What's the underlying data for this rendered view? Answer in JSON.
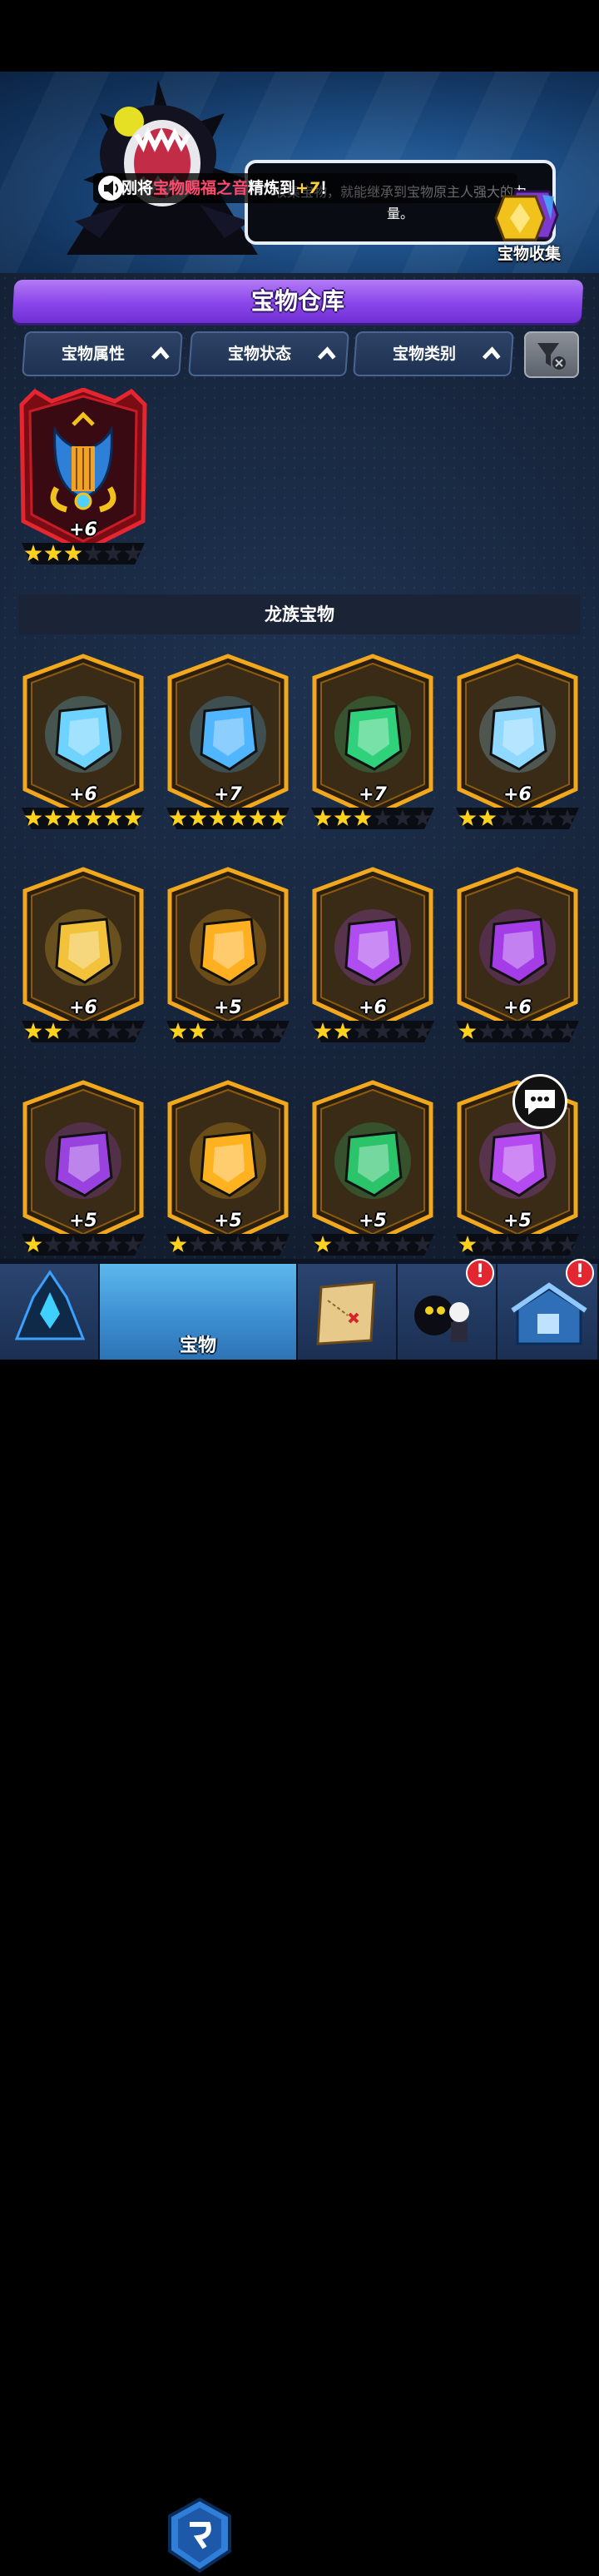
{
  "hero": {
    "dialog_text": "收集宝物，就能继承到宝物原主人强大的力量。",
    "ticker": {
      "prefix": "刚将",
      "item": "宝物赐福之音",
      "middle": "精炼到",
      "level": "+7",
      "suffix": "！"
    },
    "collection_label": "宝物收集"
  },
  "warehouse": {
    "title": "宝物仓库",
    "filters": [
      "宝物属性",
      "宝物状态",
      "宝物类别"
    ],
    "featured": {
      "level": "+6",
      "stars": 3,
      "max_stars": 6
    },
    "section_title": "龙族宝物",
    "items": [
      {
        "name": "horn-icon",
        "level": "+6",
        "stars": 6,
        "accent": "#6fd3ff"
      },
      {
        "name": "dragon-statue-icon",
        "level": "+7",
        "stars": 6,
        "accent": "#4fb6ff"
      },
      {
        "name": "green-pendant-icon",
        "level": "+7",
        "stars": 3,
        "accent": "#2fd17a"
      },
      {
        "name": "ice-scepter-icon",
        "level": "+6",
        "stars": 2,
        "accent": "#8fd8ff"
      },
      {
        "name": "net-icon",
        "level": "+6",
        "stars": 2,
        "accent": "#f2c23a"
      },
      {
        "name": "battery-icon",
        "level": "+5",
        "stars": 2,
        "accent": "#ffb020"
      },
      {
        "name": "trident-icon",
        "level": "+6",
        "stars": 2,
        "accent": "#b04df0"
      },
      {
        "name": "purple-horn-icon",
        "level": "+6",
        "stars": 1,
        "accent": "#a43de8"
      },
      {
        "name": "treasure-box-icon",
        "level": "+5",
        "stars": 1,
        "accent": "#9a42e0"
      },
      {
        "name": "bat-wing-icon",
        "level": "+5",
        "stars": 1,
        "accent": "#ffb21f"
      },
      {
        "name": "green-bottle-icon",
        "level": "+5",
        "stars": 1,
        "accent": "#2bc46a"
      },
      {
        "name": "scales-icon",
        "level": "+5",
        "stars": 1,
        "accent": "#b54af0"
      }
    ]
  },
  "nav": {
    "active_label": "宝物",
    "badge": "!"
  }
}
